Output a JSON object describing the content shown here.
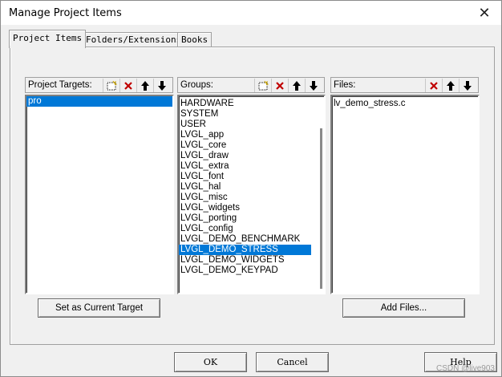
{
  "window": {
    "title": "Manage Project Items",
    "close_icon": "close-icon"
  },
  "tabs": [
    {
      "label": "Project Items",
      "active": true
    },
    {
      "label": "Folders/Extensions",
      "active": false
    },
    {
      "label": "Books",
      "active": false
    }
  ],
  "targets": {
    "label": "Project Targets:",
    "items": [
      "pro"
    ],
    "selected": "pro",
    "button": "Set as Current Target"
  },
  "groups": {
    "label": "Groups:",
    "items": [
      "HARDWARE",
      "SYSTEM",
      "USER",
      "LVGL_app",
      "LVGL_core",
      "LVGL_draw",
      "LVGL_extra",
      "LVGL_font",
      "LVGL_hal",
      "LVGL_misc",
      "LVGL_widgets",
      "LVGL_porting",
      "LVGL_config",
      "LVGL_DEMO_BENCHMARK",
      "LVGL_DEMO_STRESS",
      "LVGL_DEMO_WIDGETS",
      "LVGL_DEMO_KEYPAD"
    ],
    "selected": "LVGL_DEMO_STRESS"
  },
  "files": {
    "label": "Files:",
    "items": [
      "lv_demo_stress.c"
    ],
    "button": "Add Files..."
  },
  "footer": {
    "ok": "OK",
    "cancel": "Cancel",
    "help": "Help"
  },
  "watermark": "CSDN @live903",
  "colors": {
    "selection": "#0078d7",
    "delete": "#c00000"
  }
}
